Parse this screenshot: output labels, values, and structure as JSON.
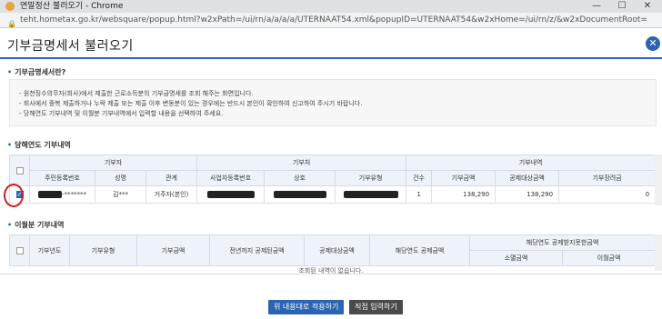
{
  "window": {
    "title": "연말정산 불러오기 - Chrome",
    "url": "teht.hometax.go.kr/websquare/popup.html?w2xPath=/ui/rn/a/a/a/a/UTERNAAT54.xml&popupID=UTERNAAT54&w2xHome=/ui/rn/z/&w2xDocumentRoot="
  },
  "header": {
    "title": "기부금명세서 불러오기"
  },
  "info": {
    "section_title": "기부금명세서란?",
    "lines": [
      "- 원천징수의무자(회사)에서 제출한 근로소득분의 기부금명세를 조회 해주는 화면입니다.",
      "- 회사에서 중복 제출하거나 누락 제출 또는 제출 이후 변동분이 있는 경우에는 반드시 본인이 확인하여 신고하여 주시기 바랍니다.",
      "- 당해연도 기부내역 및 이월분 기부내역에서 입력할 내용을 선택하여 주세요."
    ]
  },
  "current": {
    "section_title": "당해연도 기부내역",
    "group_headers": {
      "donor": "기부자",
      "recipient": "기부처",
      "details": "기부내역"
    },
    "columns": [
      "주민등록번호",
      "성명",
      "관계",
      "사업자등록번호",
      "상호",
      "기부유형",
      "건수",
      "기부금액",
      "공제대상금액",
      "기부장려금"
    ],
    "row": {
      "resident_no_suffix": "-*******",
      "name": "김***",
      "relation": "거주자(본인)",
      "count": "1",
      "amount": "138,290",
      "deductible": "138,290",
      "incentive": "0",
      "checked": true
    }
  },
  "carryover": {
    "section_title": "이월분 기부내역",
    "columns": [
      "기부년도",
      "기부유형",
      "기부금액",
      "전년까지 공제된금액",
      "공제대상금액",
      "해당연도 공제금액"
    ],
    "sub_header": "해당연도 공제받지못한금액",
    "sub_columns": [
      "소멸금액",
      "이월금액"
    ],
    "empty_message": "조회된 내역이 없습니다."
  },
  "buttons": {
    "apply": "위 내용대로 적용하기",
    "manual": "직접 입력하기"
  },
  "colors": {
    "accent": "#2a64b2",
    "dark_button": "#4a4a4a",
    "annotation": "#d42020"
  }
}
